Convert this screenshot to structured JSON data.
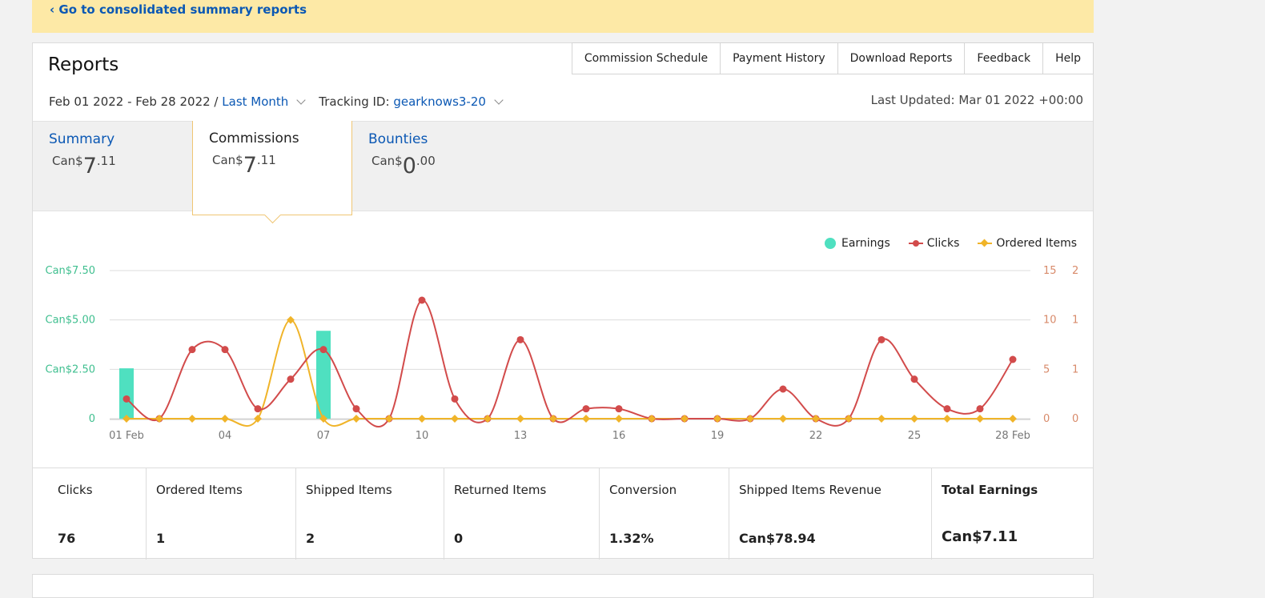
{
  "banner": {
    "link_text": "‹ Go to consolidated summary reports"
  },
  "header": {
    "title": "Reports",
    "nav": [
      "Commission Schedule",
      "Payment History",
      "Download Reports",
      "Feedback",
      "Help"
    ],
    "date_range": "Feb 01 2022 - Feb 28 2022 /",
    "period": "Last Month",
    "tracking_label": "Tracking ID:",
    "tracking_id": "gearknows3-20",
    "last_updated": "Last Updated: Mar 01 2022 +00:00"
  },
  "tabs": [
    {
      "label": "Summary",
      "currency": "Can$",
      "whole": "7",
      "cents": ".11",
      "active": false
    },
    {
      "label": "Commissions",
      "currency": "Can$",
      "whole": "7",
      "cents": ".11",
      "active": true
    },
    {
      "label": "Bounties",
      "currency": "Can$",
      "whole": "0",
      "cents": ".00",
      "active": false
    }
  ],
  "colors": {
    "earnings": "#4fe0c0",
    "clicks": "#d24b4b",
    "ordered": "#f0b429",
    "link": "#0b58b4",
    "left_axis": "#3fbf8f",
    "right_axis": "#d88a6a"
  },
  "chart_data": {
    "type": "line",
    "legend": [
      "Earnings",
      "Clicks",
      "Ordered Items"
    ],
    "legend_position": "top-right",
    "x_days": [
      1,
      2,
      3,
      4,
      5,
      6,
      7,
      8,
      9,
      10,
      11,
      12,
      13,
      14,
      15,
      16,
      17,
      18,
      19,
      20,
      21,
      22,
      23,
      24,
      25,
      26,
      27,
      28
    ],
    "x_tick_labels": [
      {
        "day": 1,
        "label": "01 Feb"
      },
      {
        "day": 4,
        "label": "04"
      },
      {
        "day": 7,
        "label": "07"
      },
      {
        "day": 10,
        "label": "10"
      },
      {
        "day": 13,
        "label": "13"
      },
      {
        "day": 16,
        "label": "16"
      },
      {
        "day": 19,
        "label": "19"
      },
      {
        "day": 22,
        "label": "22"
      },
      {
        "day": 25,
        "label": "25"
      },
      {
        "day": 28,
        "label": "28 Feb"
      }
    ],
    "left_axis": {
      "ticks": [
        0,
        2.5,
        5,
        7.5
      ],
      "labels": [
        "0",
        "Can$2.50",
        "Can$5.00",
        "Can$7.50"
      ],
      "ylim": [
        0,
        7.5
      ]
    },
    "clicks_axis": {
      "ticks": [
        0,
        5,
        10,
        15
      ],
      "labels": [
        "0",
        "5",
        "10",
        "15"
      ],
      "ylim": [
        0,
        15
      ]
    },
    "ordered_axis": {
      "ticks": [
        0,
        0.5,
        1,
        1.5
      ],
      "labels": [
        "0",
        "1",
        "1",
        "2"
      ],
      "ylim": [
        0,
        1.5
      ]
    },
    "grid": true,
    "series": [
      {
        "name": "Earnings",
        "kind": "bar",
        "axis": "left",
        "values": [
          2.55,
          0,
          0,
          0,
          0,
          0,
          4.45,
          0,
          0,
          0,
          0,
          0,
          0,
          0,
          0,
          0,
          0,
          0,
          0,
          0,
          0,
          0,
          0,
          0,
          0,
          0,
          0,
          0
        ]
      },
      {
        "name": "Clicks",
        "kind": "line",
        "axis": "clicks",
        "values": [
          2,
          0,
          7,
          7,
          1,
          4,
          7,
          1,
          0,
          12,
          2,
          0,
          8,
          0,
          1,
          1,
          0,
          0,
          0,
          0,
          3,
          0,
          0,
          8,
          4,
          1,
          1,
          6
        ]
      },
      {
        "name": "Ordered Items",
        "kind": "line",
        "axis": "ordered",
        "values": [
          0,
          0,
          0,
          0,
          0,
          1,
          0,
          0,
          0,
          0,
          0,
          0,
          0,
          0,
          0,
          0,
          0,
          0,
          0,
          0,
          0,
          0,
          0,
          0,
          0,
          0,
          0,
          0
        ]
      }
    ]
  },
  "stats": [
    {
      "label": "Clicks",
      "value": "76",
      "total": false
    },
    {
      "label": "Ordered Items",
      "value": "1",
      "total": false
    },
    {
      "label": "Shipped Items",
      "value": "2",
      "total": false
    },
    {
      "label": "Returned Items",
      "value": "0",
      "total": false
    },
    {
      "label": "Conversion",
      "value": "1.32%",
      "total": false
    },
    {
      "label": "Shipped Items Revenue",
      "value": "Can$78.94",
      "total": false
    },
    {
      "label": "Total Earnings",
      "value": "Can$7.11",
      "total": true
    }
  ]
}
